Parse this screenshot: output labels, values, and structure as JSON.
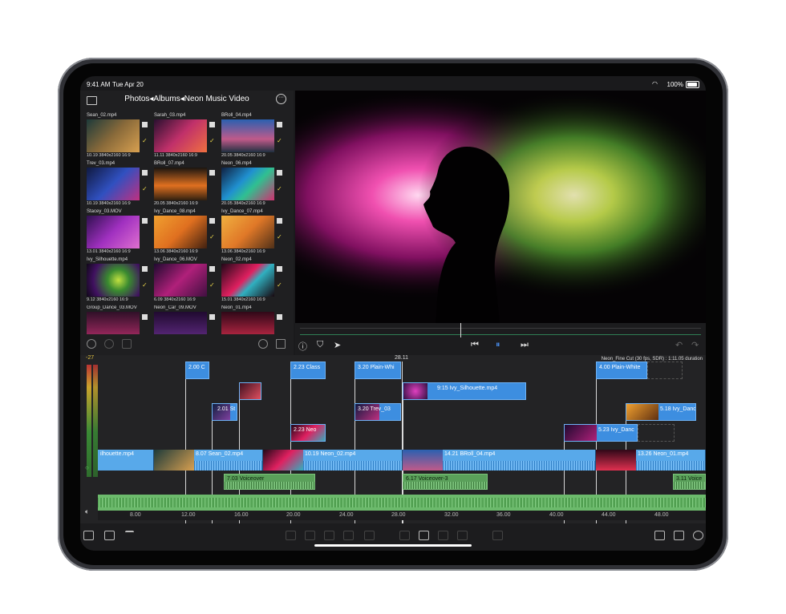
{
  "status": {
    "time": "9:41 AM",
    "date": "Tue Apr 20",
    "battery": "100%"
  },
  "browser": {
    "breadcrumb": "Photos◂Albums◂Neon Music Video",
    "items": [
      {
        "name": "Sean_02.mp4",
        "meta": "10.19  3840x2160  16:9",
        "checked": true
      },
      {
        "name": "Sarah_03.mp4",
        "meta": "11.11  3840x2160  16:9",
        "checked": true
      },
      {
        "name": "BRoll_04.mp4",
        "meta": "20.05  3840x2160  16:9",
        "checked": true
      },
      {
        "name": "Trev_03.mp4",
        "meta": "10.19  3840x2160  16:9",
        "checked": true
      },
      {
        "name": "BRoll_07.mp4",
        "meta": "20.05  3840x2160  16:9",
        "checked": false
      },
      {
        "name": "Neon_06.mp4",
        "meta": "20.05  3840x2160  16:9",
        "checked": true
      },
      {
        "name": "Stacey_03.MOV",
        "meta": "13.01  3840x2160  16:9",
        "checked": false
      },
      {
        "name": "Ivy_Dance_08.mp4",
        "meta": "13.06  3840x2160  16:9",
        "checked": true
      },
      {
        "name": "Ivy_Dance_07.mp4",
        "meta": "13.06  3840x2160  16:9",
        "checked": true
      },
      {
        "name": "Ivy_Silhouette.mp4",
        "meta": "9.12  3840x2160  16:9",
        "checked": true
      },
      {
        "name": "Ivy_Dance_06.MOV",
        "meta": "6.09  3840x2160  16:9",
        "checked": true
      },
      {
        "name": "Neon_02.mp4",
        "meta": "15.01  3840x2160  16:9",
        "checked": true
      },
      {
        "name": "Group_Dance_03.MOV",
        "meta": "",
        "checked": false
      },
      {
        "name": "Neon_Car_09.MOV",
        "meta": "",
        "checked": false
      },
      {
        "name": "Neon_01.mp4",
        "meta": "",
        "checked": false
      }
    ]
  },
  "timeline": {
    "playhead_tc": "28.11",
    "project_info": "Neon_Fine Cut (30 fps, SDR) : 1:11.05 duration",
    "meter_db": "-27",
    "connected": [
      {
        "label": "2.00  C"
      },
      {
        "label": "2.23  Class"
      },
      {
        "label": "3.20  Plain-Whi"
      },
      {
        "label": "4.00  Plain-White"
      },
      {
        "label": "9:15  Ivy_Silhouette.mp4"
      },
      {
        "label": "2.01  St"
      },
      {
        "label": "3.20  Trev_03"
      },
      {
        "label": "5.18  Ivy_Danc"
      },
      {
        "label": "2.23  Neo"
      },
      {
        "label": "5.23  Ivy_Danc"
      }
    ],
    "primary": [
      {
        "label": "ilhouette.mp4"
      },
      {
        "label": "8.07  Sean_02.mp4"
      },
      {
        "label": "10.19  Neon_02.mp4"
      },
      {
        "label": "14.21  BRoll_04.mp4"
      },
      {
        "label": "13.26  Neon_01.mp4"
      }
    ],
    "voiceovers": [
      {
        "label": "7.03  Voiceover"
      },
      {
        "label": "6.17  Voiceover-3"
      },
      {
        "label": "3.11  Voice"
      }
    ],
    "ruler": [
      "8.00",
      "12.00",
      "16.00",
      "20.00",
      "24.00",
      "28.00",
      "32.00",
      "36.00",
      "40.00",
      "44.00",
      "48.00"
    ]
  },
  "icons": [
    "folder-icon",
    "more-icon",
    "select-icon",
    "record-icon",
    "trash-icon",
    "search-icon",
    "sort-icon",
    "info-icon",
    "marker-icon",
    "share-frame-icon",
    "skip-back-icon",
    "play-pause-icon",
    "skip-forward-icon",
    "undo-icon",
    "redo-icon",
    "speaker-icon",
    "import-icon",
    "inspector-icon",
    "index-icon",
    "layout-icon",
    "share-icon",
    "settings-icon"
  ]
}
